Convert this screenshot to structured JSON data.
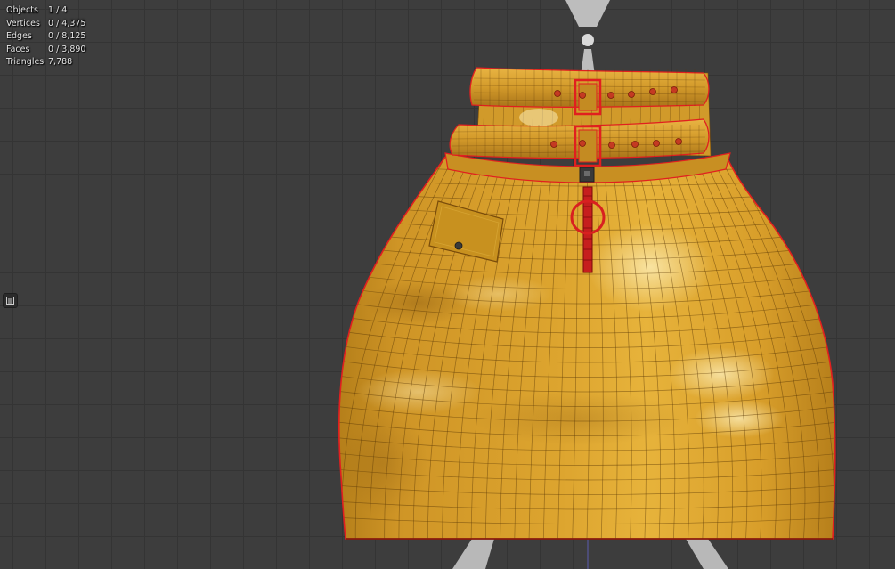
{
  "statistics": {
    "objects": {
      "label": "Objects",
      "value": "1 / 4"
    },
    "vertices": {
      "label": "Vertices",
      "value": "0 / 4,375"
    },
    "edges": {
      "label": "Edges",
      "value": "0 / 8,125"
    },
    "faces": {
      "label": "Faces",
      "value": "0 / 3,890"
    },
    "triangles": {
      "label": "Triangles",
      "value": "7,788"
    }
  },
  "colors": {
    "viewport_bg": "#3d3d3d",
    "grid_line": "#343434",
    "mesh_fill": "#dca22c",
    "wireframe": "#5a3a0a",
    "selection_outline": "#e02020",
    "mannequin": "#bcbcbc"
  },
  "icons": {
    "sidebar_toggle": "sidebar-toggle-icon"
  }
}
